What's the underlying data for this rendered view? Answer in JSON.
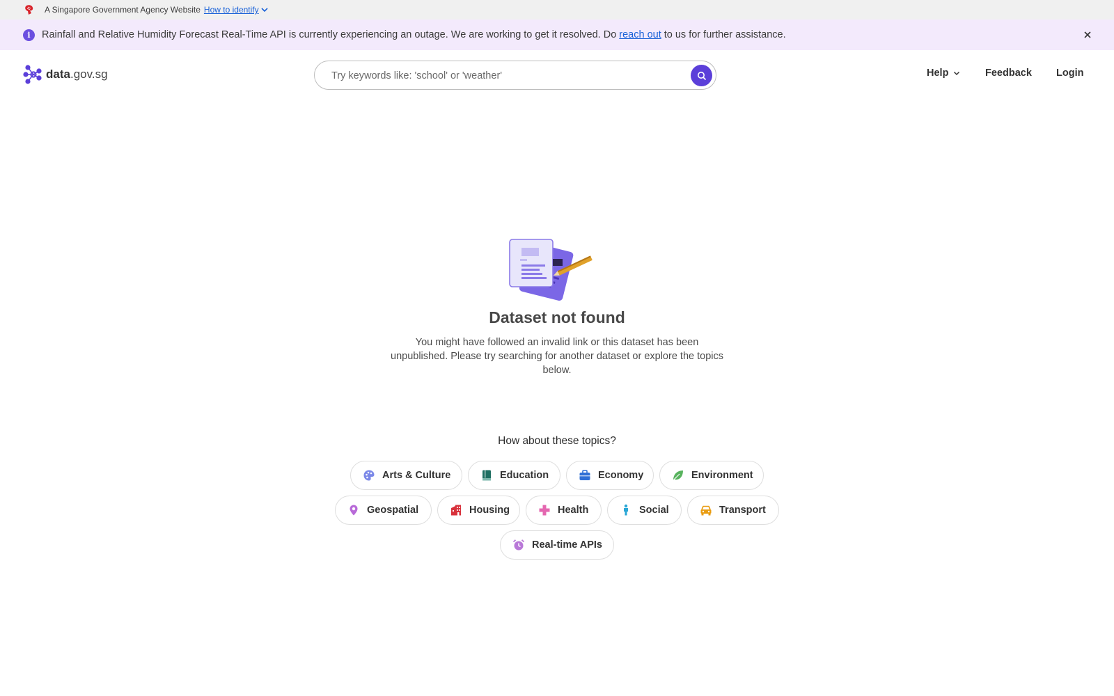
{
  "masthead": {
    "text": "A Singapore Government Agency Website",
    "identify_link": "How to identify",
    "lion_icon": "singapore-lion-icon",
    "lion_color": "#d8232a"
  },
  "banner": {
    "text_before": "Rainfall and Relative Humidity Forecast Real-Time API is currently experiencing an outage. We are working to get it resolved. Do",
    "link": "reach out",
    "text_after": "to us for further assistance.",
    "background": "#f3eafc",
    "icon": "info-icon",
    "close_icon": "close-icon"
  },
  "header": {
    "logo_bold": "data",
    "logo_rest": ".gov.sg",
    "search_placeholder": "Try keywords like: 'school' or 'weather'",
    "accent": "#5b3fd9",
    "nav": {
      "help": "Help",
      "feedback": "Feedback",
      "login": "Login"
    }
  },
  "main": {
    "illustration": "document-pencil-illustration",
    "title": "Dataset not found",
    "description": "You might have followed an invalid link or this dataset has been unpublished. Please try searching for another dataset or explore the topics below.",
    "topics_heading": "How about these topics?",
    "topics": [
      {
        "label": "Arts & Culture",
        "icon": "palette-icon",
        "color": "#7b88e8"
      },
      {
        "label": "Education",
        "icon": "book-icon",
        "color": "#1f6f62"
      },
      {
        "label": "Economy",
        "icon": "briefcase-icon",
        "color": "#2f6fd6"
      },
      {
        "label": "Environment",
        "icon": "leaf-icon",
        "color": "#58b35e"
      },
      {
        "label": "Geospatial",
        "icon": "map-pin-icon",
        "color": "#b86ad8"
      },
      {
        "label": "Housing",
        "icon": "building-icon",
        "color": "#d8323c"
      },
      {
        "label": "Health",
        "icon": "health-cross-icon",
        "color": "#e467b0"
      },
      {
        "label": "Social",
        "icon": "person-icon",
        "color": "#2aa7d6"
      },
      {
        "label": "Transport",
        "icon": "car-icon",
        "color": "#e99c10"
      },
      {
        "label": "Real-time APIs",
        "icon": "alarm-clock-icon",
        "color": "#b978d8"
      }
    ]
  }
}
